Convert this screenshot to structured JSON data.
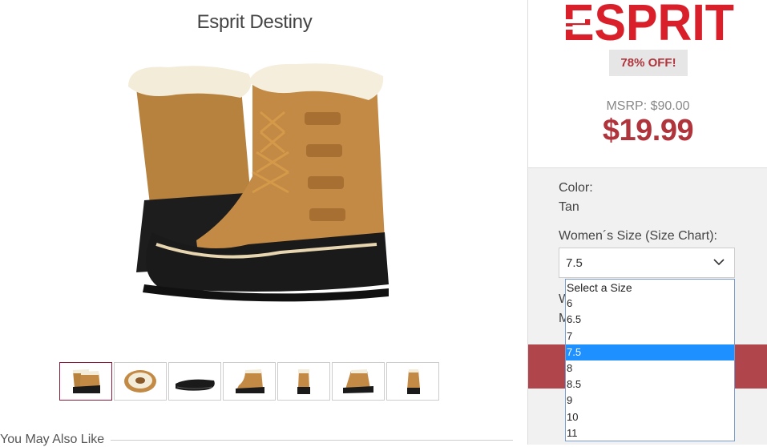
{
  "product": {
    "title": "Esprit Destiny"
  },
  "thumbnails": [
    "boot-pair-side",
    "boot-top-fur",
    "boot-sole",
    "boot-single-side",
    "boot-front",
    "boot-angle",
    "boot-single-right"
  ],
  "related": {
    "heading": "You May Also Like"
  },
  "brand": {
    "logo_text": "ESPRIT",
    "color": "#d81f2a"
  },
  "pricing": {
    "discount": "78% OFF!",
    "msrp": "MSRP: $90.00",
    "price": "$19.99",
    "price_color": "#b0343c"
  },
  "options": {
    "color_label": "Color:",
    "color_value": "Tan",
    "size_label": "Women´s Size (Size Chart):",
    "size_selected": "7.5",
    "width_label_partial": "W",
    "hidden_row_partial": "M"
  },
  "size_dropdown": {
    "options": [
      "Select a Size",
      "6",
      "6.5",
      "7",
      "7.5",
      "8",
      "8.5",
      "9",
      "10",
      "11"
    ],
    "selected": "7.5"
  },
  "colors": {
    "cta": "#b0464b",
    "highlight": "#1e90ff"
  }
}
